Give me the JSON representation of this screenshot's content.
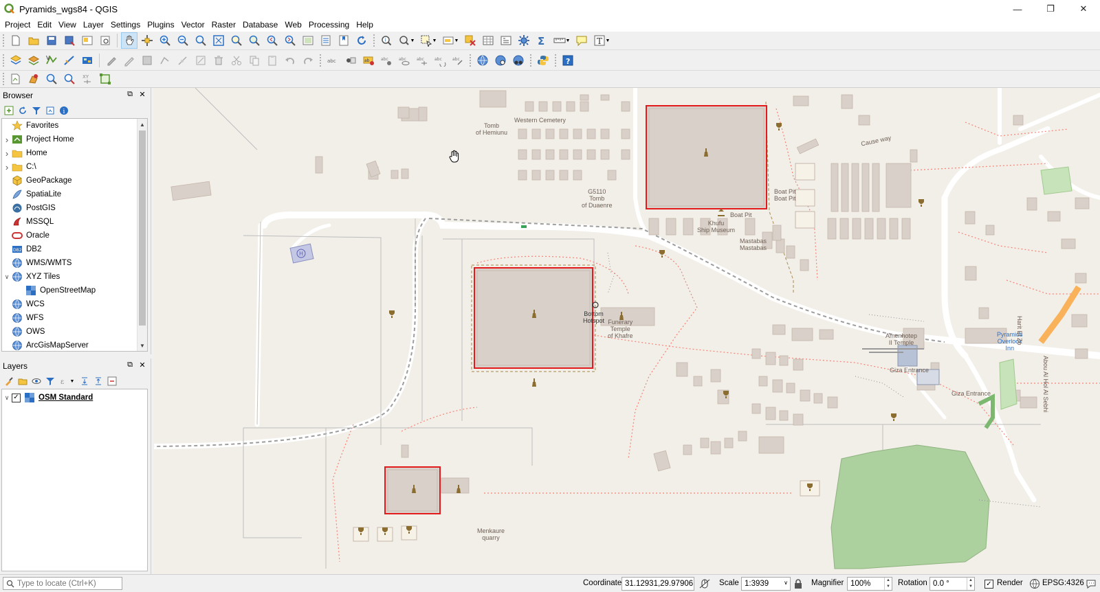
{
  "window": {
    "title": "Pyramids_wgs84 - QGIS",
    "controls": {
      "minimize": "—",
      "maximize": "❐",
      "close": "✕"
    }
  },
  "menu": [
    "Project",
    "Edit",
    "View",
    "Layer",
    "Settings",
    "Plugins",
    "Vector",
    "Raster",
    "Database",
    "Web",
    "Processing",
    "Help"
  ],
  "browser": {
    "title": "Browser",
    "items": [
      {
        "label": "Favorites",
        "icon": "star-icon",
        "expandable": false,
        "indent": 0
      },
      {
        "label": "Project Home",
        "icon": "project-home-icon",
        "expandable": true,
        "indent": 0
      },
      {
        "label": "Home",
        "icon": "folder-icon",
        "expandable": true,
        "indent": 0
      },
      {
        "label": "C:\\",
        "icon": "folder-icon",
        "expandable": true,
        "indent": 0
      },
      {
        "label": "GeoPackage",
        "icon": "geopackage-icon",
        "expandable": false,
        "indent": 0
      },
      {
        "label": "SpatiaLite",
        "icon": "spatialite-icon",
        "expandable": false,
        "indent": 0
      },
      {
        "label": "PostGIS",
        "icon": "postgis-icon",
        "expandable": false,
        "indent": 0
      },
      {
        "label": "MSSQL",
        "icon": "mssql-icon",
        "expandable": false,
        "indent": 0
      },
      {
        "label": "Oracle",
        "icon": "oracle-icon",
        "expandable": false,
        "indent": 0
      },
      {
        "label": "DB2",
        "icon": "db2-icon",
        "expandable": false,
        "indent": 0
      },
      {
        "label": "WMS/WMTS",
        "icon": "globe-icon",
        "expandable": false,
        "indent": 0
      },
      {
        "label": "XYZ Tiles",
        "icon": "globe-icon",
        "expandable": true,
        "expanded": true,
        "indent": 0
      },
      {
        "label": "OpenStreetMap",
        "icon": "tile-layer-icon",
        "expandable": false,
        "indent": 1
      },
      {
        "label": "WCS",
        "icon": "globe-icon",
        "expandable": false,
        "indent": 0
      },
      {
        "label": "WFS",
        "icon": "globe-icon",
        "expandable": false,
        "indent": 0
      },
      {
        "label": "OWS",
        "icon": "globe-icon",
        "expandable": false,
        "indent": 0
      },
      {
        "label": "ArcGisMapServer",
        "icon": "globe-icon",
        "expandable": false,
        "indent": 0
      }
    ]
  },
  "layers": {
    "title": "Layers",
    "items": [
      {
        "label": "OSM Standard",
        "checked": true,
        "icon": "tile-layer-icon"
      }
    ]
  },
  "map": {
    "labels": [
      {
        "text": "Western Cemetery",
        "name": "label-western-cemetery"
      },
      {
        "text": "Tomb\nof Hemiunu",
        "name": "label-tomb-hemiunu"
      },
      {
        "text": "G5110\nTomb\nof Duaenre",
        "name": "label-tomb-duaenre"
      },
      {
        "text": "Cause way",
        "name": "label-causeway"
      },
      {
        "text": "Boat Pit",
        "name": "label-boat-pit-1"
      },
      {
        "text": "Boat Pit",
        "name": "label-boat-pit-2"
      },
      {
        "text": "Boat Pit",
        "name": "label-boat-pit-3"
      },
      {
        "text": "Khufu\nShip Museum",
        "name": "label-khufu-ship-museum"
      },
      {
        "text": "Mastabas\nMastabas",
        "name": "label-mastabas"
      },
      {
        "text": "Funerary\nTemple\nof Khafre",
        "name": "label-funerary-temple"
      },
      {
        "text": "Bottom\nHotspot",
        "name": "label-hotspot"
      },
      {
        "text": "Amenhotep\nII Temple",
        "name": "label-amenhotep"
      },
      {
        "text": "Giza Entrance",
        "name": "label-giza-entrance-1"
      },
      {
        "text": "Giza Entrance",
        "name": "label-giza-entrance-2"
      },
      {
        "text": "Pyramids\nOverlook\nInn",
        "name": "label-pyramids-overlook"
      },
      {
        "text": "Menkaure\nquarry",
        "name": "label-menkaure-quarry"
      },
      {
        "text": "Harit El Zo",
        "name": "label-harit-el-zo"
      },
      {
        "text": "Abou Al Hol Al Sebhi",
        "name": "label-abou-al-hol"
      }
    ]
  },
  "status": {
    "locator_placeholder": "Type to locate (Ctrl+K)",
    "coordinate_label": "Coordinate",
    "coordinate_value": "31.12931,29.97906",
    "scale_label": "Scale",
    "scale_value": "1:3939",
    "magnifier_label": "Magnifier",
    "magnifier_value": "100%",
    "rotation_label": "Rotation",
    "rotation_value": "0.0 °",
    "render_label": "Render",
    "render_checked": true,
    "crs": "EPSG:4326"
  },
  "colors": {
    "map_bg": "#f2efe9",
    "building": "#d9d0c9",
    "selection": "#e31a1c",
    "road": "#ffffff",
    "path": "#fa8072",
    "park": "#add19e"
  }
}
